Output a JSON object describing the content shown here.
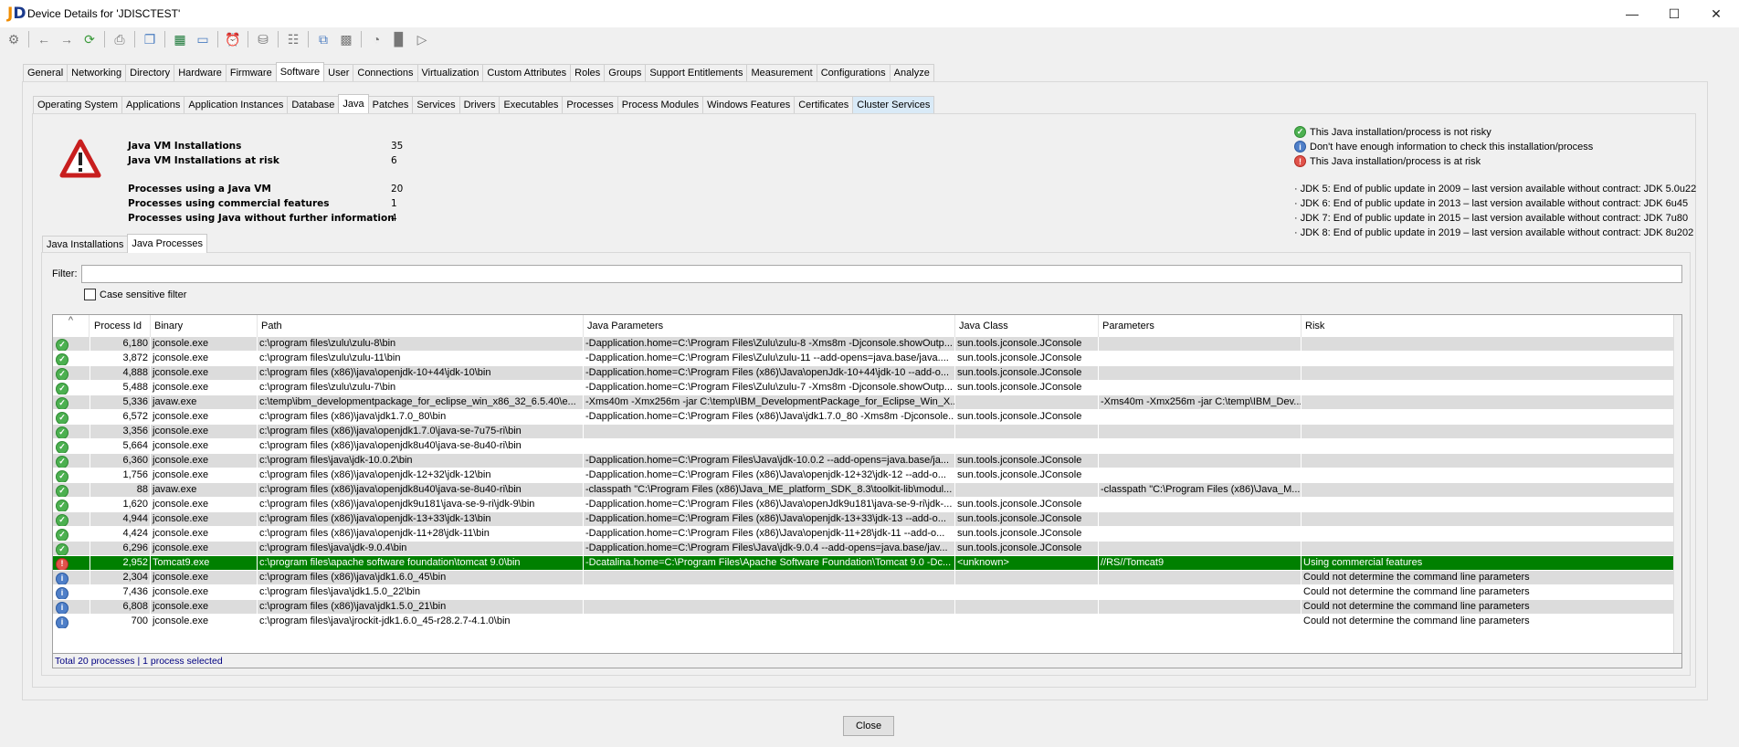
{
  "window": {
    "title": "Device Details for 'JDISCTEST'",
    "controls": [
      "minimize",
      "maximize",
      "close"
    ]
  },
  "toolbar": {
    "icons": [
      "gear-icon",
      "back-icon",
      "forward-icon",
      "refresh-icon",
      "print-icon",
      "copy-icon",
      "excel-icon",
      "document-icon",
      "alarm-clock-icon",
      "database-icon",
      "hierarchy-icon",
      "copy-table-icon",
      "table-icon",
      "pie-chart-icon",
      "bar-chart-icon",
      "chart-off-icon"
    ]
  },
  "main_tabs": [
    "General",
    "Networking",
    "Directory",
    "Hardware",
    "Firmware",
    "Software",
    "User",
    "Connections",
    "Virtualization",
    "Custom Attributes",
    "Roles",
    "Groups",
    "Support Entitlements",
    "Measurement",
    "Configurations",
    "Analyze"
  ],
  "main_tab_active": "Software",
  "sub_tabs": [
    "Operating System",
    "Applications",
    "Application Instances",
    "Database",
    "Java",
    "Patches",
    "Services",
    "Drivers",
    "Executables",
    "Processes",
    "Process Modules",
    "Windows Features",
    "Certificates",
    "Cluster Services"
  ],
  "sub_tab_active": "Java",
  "sub_tab_highlight": "Cluster Services",
  "summary": [
    {
      "label": "Java VM Installations",
      "value": "35"
    },
    {
      "label": "Java VM Installations at risk",
      "value": "6"
    },
    {
      "label": "Processes using a Java VM",
      "value": "20"
    },
    {
      "label": "Processes using commercial features",
      "value": "1"
    },
    {
      "label": "Processes using Java without further information",
      "value": "4"
    }
  ],
  "legend": [
    {
      "status": "ok",
      "text": "This Java installation/process is not risky"
    },
    {
      "status": "info",
      "text": "Don't have enough information to check this installation/process"
    },
    {
      "status": "risk",
      "text": "This Java installation/process is at risk"
    }
  ],
  "jdk_notes": [
    "· JDK 5: End of public update in 2009 – last version available without contract: JDK 5.0u22",
    "· JDK 6: End of public update in 2013 – last version available without contract: JDK 6u45",
    "· JDK 7: End of public update in 2015 – last version available without contract: JDK 7u80",
    "· JDK 8: End of public update in 2019 – last version available without contract: JDK 8u202"
  ],
  "inner_tabs": [
    "Java Installations",
    "Java Processes"
  ],
  "inner_tab_active": "Java Processes",
  "filter": {
    "label": "Filter:",
    "value": "",
    "checkbox_label": "Case sensitive filter",
    "checked": false
  },
  "table": {
    "sort_indicator": "^",
    "columns": [
      "Process Id",
      "Binary",
      "Path",
      "Java Parameters",
      "Java Class",
      "Parameters",
      "Risk"
    ],
    "rows": [
      {
        "status": "ok",
        "pid": "6,180",
        "binary": "jconsole.exe",
        "path": "c:\\program files\\zulu\\zulu-8\\bin",
        "jparams": "-Dapplication.home=C:\\Program Files\\Zulu\\zulu-8 -Xms8m -Djconsole.showOutp...",
        "jclass": "sun.tools.jconsole.JConsole",
        "params": "",
        "risk": ""
      },
      {
        "status": "ok",
        "pid": "3,872",
        "binary": "jconsole.exe",
        "path": "c:\\program files\\zulu\\zulu-11\\bin",
        "jparams": "-Dapplication.home=C:\\Program Files\\Zulu\\zulu-11 --add-opens=java.base/java....",
        "jclass": "sun.tools.jconsole.JConsole",
        "params": "",
        "risk": ""
      },
      {
        "status": "ok",
        "pid": "4,888",
        "binary": "jconsole.exe",
        "path": "c:\\program files (x86)\\java\\openjdk-10+44\\jdk-10\\bin",
        "jparams": "-Dapplication.home=C:\\Program Files (x86)\\Java\\openJdk-10+44\\jdk-10 --add-o...",
        "jclass": "sun.tools.jconsole.JConsole",
        "params": "",
        "risk": ""
      },
      {
        "status": "ok",
        "pid": "5,488",
        "binary": "jconsole.exe",
        "path": "c:\\program files\\zulu\\zulu-7\\bin",
        "jparams": "-Dapplication.home=C:\\Program Files\\Zulu\\zulu-7 -Xms8m -Djconsole.showOutp...",
        "jclass": "sun.tools.jconsole.JConsole",
        "params": "",
        "risk": ""
      },
      {
        "status": "ok",
        "pid": "5,336",
        "binary": "javaw.exe",
        "path": "c:\\temp\\ibm_developmentpackage_for_eclipse_win_x86_32_6.5.40\\e...",
        "jparams": "-Xms40m -Xmx256m -jar C:\\temp\\IBM_DevelopmentPackage_for_Eclipse_Win_X...",
        "jclass": "",
        "params": "-Xms40m -Xmx256m -jar C:\\temp\\IBM_Dev...",
        "risk": ""
      },
      {
        "status": "ok",
        "pid": "6,572",
        "binary": "jconsole.exe",
        "path": "c:\\program files (x86)\\java\\jdk1.7.0_80\\bin",
        "jparams": "-Dapplication.home=C:\\Program Files (x86)\\Java\\jdk1.7.0_80 -Xms8m -Djconsole...",
        "jclass": "sun.tools.jconsole.JConsole",
        "params": "",
        "risk": ""
      },
      {
        "status": "ok",
        "pid": "3,356",
        "binary": "jconsole.exe",
        "path": "c:\\program files (x86)\\java\\openjdk1.7.0\\java-se-7u75-ri\\bin",
        "jparams": "",
        "jclass": "",
        "params": "",
        "risk": ""
      },
      {
        "status": "ok",
        "pid": "5,664",
        "binary": "jconsole.exe",
        "path": "c:\\program files (x86)\\java\\openjdk8u40\\java-se-8u40-ri\\bin",
        "jparams": "",
        "jclass": "",
        "params": "",
        "risk": ""
      },
      {
        "status": "ok",
        "pid": "6,360",
        "binary": "jconsole.exe",
        "path": "c:\\program files\\java\\jdk-10.0.2\\bin",
        "jparams": "-Dapplication.home=C:\\Program Files\\Java\\jdk-10.0.2 --add-opens=java.base/ja...",
        "jclass": "sun.tools.jconsole.JConsole",
        "params": "",
        "risk": ""
      },
      {
        "status": "ok",
        "pid": "1,756",
        "binary": "jconsole.exe",
        "path": "c:\\program files (x86)\\java\\openjdk-12+32\\jdk-12\\bin",
        "jparams": "-Dapplication.home=C:\\Program Files (x86)\\Java\\openjdk-12+32\\jdk-12 --add-o...",
        "jclass": "sun.tools.jconsole.JConsole",
        "params": "",
        "risk": ""
      },
      {
        "status": "ok",
        "pid": "88",
        "binary": "javaw.exe",
        "path": "c:\\program files (x86)\\java\\openjdk8u40\\java-se-8u40-ri\\bin",
        "jparams": "-classpath \"C:\\Program Files (x86)\\Java_ME_platform_SDK_8.3\\toolkit-lib\\modul...",
        "jclass": "",
        "params": "-classpath \"C:\\Program Files (x86)\\Java_M...",
        "risk": ""
      },
      {
        "status": "ok",
        "pid": "1,620",
        "binary": "jconsole.exe",
        "path": "c:\\program files (x86)\\java\\openjdk9u181\\java-se-9-ri\\jdk-9\\bin",
        "jparams": "-Dapplication.home=C:\\Program Files (x86)\\Java\\openJdk9u181\\java-se-9-ri\\jdk-...",
        "jclass": "sun.tools.jconsole.JConsole",
        "params": "",
        "risk": ""
      },
      {
        "status": "ok",
        "pid": "4,944",
        "binary": "jconsole.exe",
        "path": "c:\\program files (x86)\\java\\openjdk-13+33\\jdk-13\\bin",
        "jparams": "-Dapplication.home=C:\\Program Files (x86)\\Java\\openjdk-13+33\\jdk-13 --add-o...",
        "jclass": "sun.tools.jconsole.JConsole",
        "params": "",
        "risk": ""
      },
      {
        "status": "ok",
        "pid": "4,424",
        "binary": "jconsole.exe",
        "path": "c:\\program files (x86)\\java\\openjdk-11+28\\jdk-11\\bin",
        "jparams": "-Dapplication.home=C:\\Program Files (x86)\\Java\\openjdk-11+28\\jdk-11 --add-o...",
        "jclass": "sun.tools.jconsole.JConsole",
        "params": "",
        "risk": ""
      },
      {
        "status": "ok",
        "pid": "6,296",
        "binary": "jconsole.exe",
        "path": "c:\\program files\\java\\jdk-9.0.4\\bin",
        "jparams": "-Dapplication.home=C:\\Program Files\\Java\\jdk-9.0.4 --add-opens=java.base/jav...",
        "jclass": "sun.tools.jconsole.JConsole",
        "params": "",
        "risk": ""
      },
      {
        "status": "risk",
        "selected": true,
        "pid": "2,952",
        "binary": "Tomcat9.exe",
        "path": "c:\\program files\\apache software foundation\\tomcat 9.0\\bin",
        "jparams": "-Dcatalina.home=C:\\Program Files\\Apache Software Foundation\\Tomcat 9.0 -Dc...",
        "jclass": "<unknown>",
        "params": "//RS//Tomcat9",
        "risk": "Using commercial features"
      },
      {
        "status": "info",
        "pid": "2,304",
        "binary": "jconsole.exe",
        "path": "c:\\program files (x86)\\java\\jdk1.6.0_45\\bin",
        "jparams": "",
        "jclass": "",
        "params": "",
        "risk": "Could not determine the command line parameters"
      },
      {
        "status": "info",
        "pid": "7,436",
        "binary": "jconsole.exe",
        "path": "c:\\program files\\java\\jdk1.5.0_22\\bin",
        "jparams": "",
        "jclass": "",
        "params": "",
        "risk": "Could not determine the command line parameters"
      },
      {
        "status": "info",
        "pid": "6,808",
        "binary": "jconsole.exe",
        "path": "c:\\program files (x86)\\java\\jdk1.5.0_21\\bin",
        "jparams": "",
        "jclass": "",
        "params": "",
        "risk": "Could not determine the command line parameters"
      },
      {
        "status": "info",
        "pid": "700",
        "binary": "jconsole.exe",
        "path": "c:\\program files\\java\\jrockit-jdk1.6.0_45-r28.2.7-4.1.0\\bin",
        "jparams": "",
        "jclass": "",
        "params": "",
        "risk": "Could not determine the command line parameters"
      }
    ]
  },
  "status_bar": "Total 20 processes | 1 process selected",
  "close_label": "Close",
  "colors": {
    "selected_row": "#008000",
    "stripe": "#dcdcdc",
    "ok": "#4cb050",
    "info": "#4f7fc8",
    "risk": "#e0524a"
  }
}
